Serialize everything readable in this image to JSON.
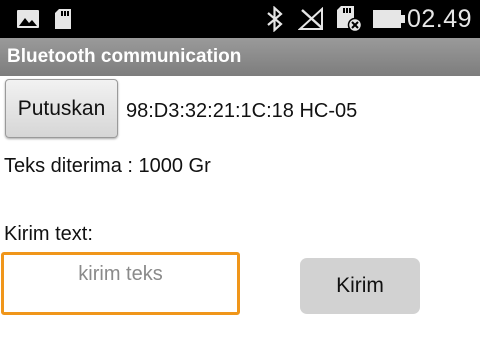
{
  "status_bar": {
    "time": "02.49",
    "icons": [
      "image-icon",
      "sd-card-icon",
      "bluetooth-icon",
      "no-signal-icon",
      "sd-card-removed-icon",
      "battery-icon"
    ]
  },
  "app": {
    "title": "Bluetooth communication"
  },
  "connection": {
    "disconnect_label": "Putuskan",
    "device": "98:D3:32:21:1C:18 HC-05"
  },
  "received": {
    "text": "Teks diterima : 1000 Gr"
  },
  "send": {
    "label": "Kirim text:",
    "input_placeholder": "kirim teks",
    "input_value": "",
    "button_label": "Kirim"
  },
  "colors": {
    "status_bar_bg": "#000000",
    "title_bar_bg": "#8a8a8a",
    "input_focus_border": "#f0961a",
    "send_button_bg": "#d2d2d2"
  }
}
